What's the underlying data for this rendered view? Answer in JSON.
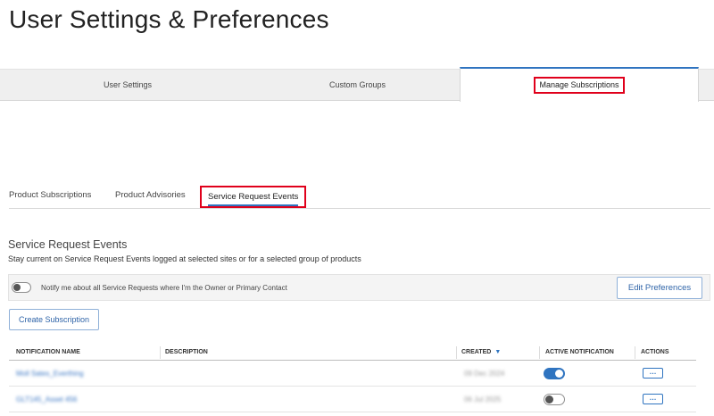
{
  "page": {
    "title": "User Settings & Preferences"
  },
  "main_tabs": [
    {
      "label": "User Settings"
    },
    {
      "label": "Custom Groups"
    },
    {
      "label": "Manage Subscriptions",
      "active": true
    }
  ],
  "sub_tabs": [
    {
      "label": "Product Subscriptions"
    },
    {
      "label": "Product Advisories"
    },
    {
      "label": "Service Request Events",
      "active": true
    }
  ],
  "section": {
    "title": "Service Request Events",
    "description": "Stay current on Service Request Events logged at selected sites or for a selected group of products"
  },
  "notify": {
    "label": "Notify me about all Service Requests where I'm the Owner or Primary Contact",
    "enabled": false,
    "edit_button": "Edit Preferences"
  },
  "create_button": "Create Subscription",
  "table": {
    "columns": {
      "name": "NOTIFICATION NAME",
      "description": "DESCRIPTION",
      "created": "CREATED",
      "active": "ACTIVE NOTIFICATION",
      "actions": "ACTIONS"
    },
    "rows": [
      {
        "name": "Moll Sates_Everthing",
        "description": "",
        "created": "09 Dec 2024",
        "active": true,
        "action_label": "…"
      },
      {
        "name": "GLT145_Asset 456",
        "description": "",
        "created": "06 Jul 2025",
        "active": false,
        "action_label": "…"
      }
    ]
  },
  "colors": {
    "accent": "#2f74c0",
    "highlight": "#e0001b",
    "tab_bg": "#efefef"
  }
}
